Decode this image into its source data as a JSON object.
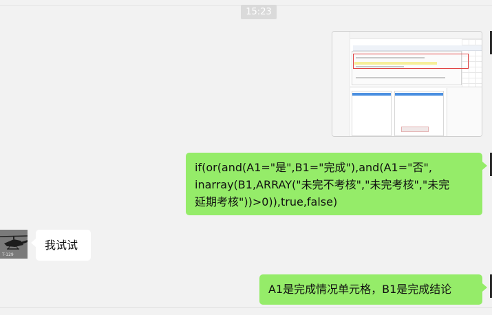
{
  "timestamp": "15:23",
  "messages": [
    {
      "sender": "self",
      "type": "image"
    },
    {
      "sender": "self",
      "type": "text",
      "lines": [
        "if(or(and(A1=\"是\",B1=\"完成\"),and(A1=\"否\",",
        "inarray(B1,ARRAY(\"未完不考核\",\"未完考核\",\"未完",
        "延期考核\"))>0)),true,false)"
      ]
    },
    {
      "sender": "other",
      "type": "text",
      "text": "我试试",
      "avatar_icon": "helicopter-avatar"
    },
    {
      "sender": "self",
      "type": "text",
      "text": "A1是完成情况单元格，B1是完成结论"
    }
  ],
  "colors": {
    "background": "#f2f2f2",
    "self_bubble": "#95ec69",
    "other_bubble": "#ffffff",
    "timestamp_bg": "#dadada"
  }
}
